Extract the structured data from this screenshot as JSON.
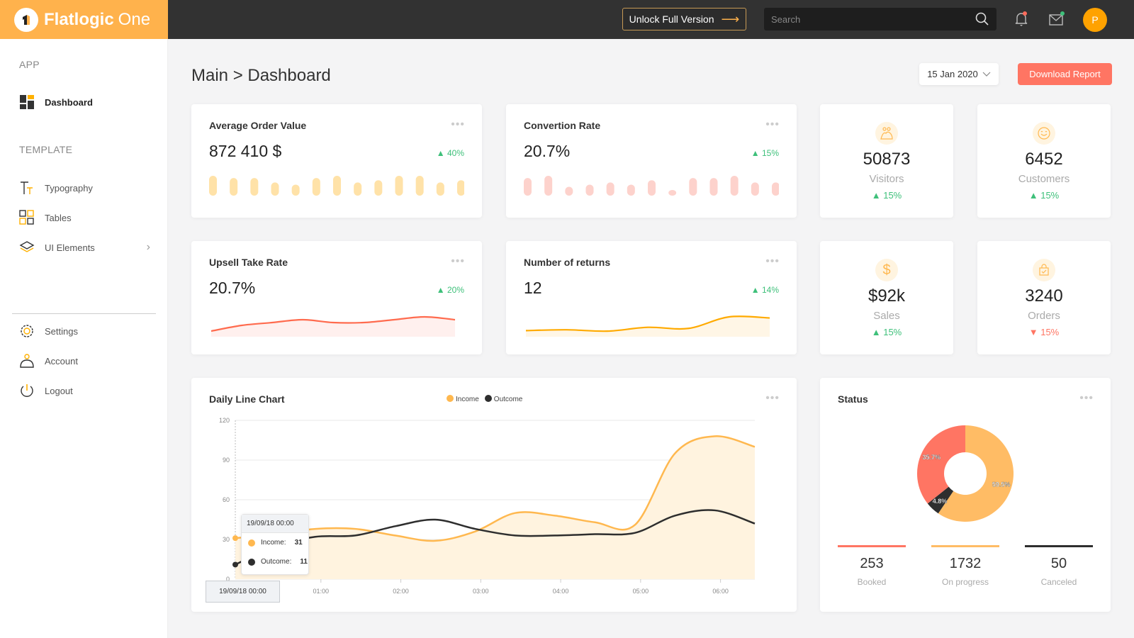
{
  "app": {
    "brand_bold": "Flatlogic",
    "brand_light": "One"
  },
  "topbar": {
    "unlock_label": "Unlock Full Version",
    "search_placeholder": "Search",
    "avatar_initial": "P",
    "colors": {
      "brand": "#ffb24c",
      "dark": "#323232",
      "notif_dot": "#ff6b5b",
      "mail_dot": "#3ec07a"
    }
  },
  "sidebar": {
    "sections": [
      {
        "label": "APP",
        "items": [
          {
            "label": "Dashboard",
            "icon": "dashboard-icon",
            "active": true
          }
        ]
      },
      {
        "label": "TEMPLATE",
        "items": [
          {
            "label": "Typography",
            "icon": "typography-icon"
          },
          {
            "label": "Tables",
            "icon": "tables-icon"
          },
          {
            "label": "UI Elements",
            "icon": "layers-icon",
            "has_submenu": true
          }
        ]
      }
    ],
    "bottom_items": [
      {
        "label": "Settings",
        "icon": "gear-icon"
      },
      {
        "label": "Account",
        "icon": "account-icon"
      },
      {
        "label": "Logout",
        "icon": "power-icon"
      }
    ]
  },
  "header": {
    "breadcrumb": "Main > Dashboard",
    "date": "15 Jan 2020",
    "download_label": "Download Report"
  },
  "kpis": [
    {
      "title": "Average Order Value",
      "value": "872 410 $",
      "delta": "40%",
      "trend": "up",
      "spark_type": "bars",
      "color": "#ffe2a8",
      "spark": [
        9,
        8,
        8,
        6,
        5,
        8,
        9,
        6,
        7,
        9,
        9,
        6,
        7
      ]
    },
    {
      "title": "Convertion Rate",
      "value": "20.7%",
      "delta": "15%",
      "trend": "up",
      "spark_type": "bars",
      "color": "#fdd2cc",
      "spark": [
        8,
        9,
        4,
        5,
        6,
        5,
        7,
        2,
        8,
        8,
        9,
        6,
        6
      ]
    },
    {
      "title": "Upsell Take Rate",
      "value": "20.7%",
      "delta": "20%",
      "trend": "up",
      "spark_type": "line",
      "color": "#ff6b4e",
      "fill": "#fff0ee",
      "spark": [
        2,
        4,
        5,
        6,
        5,
        5,
        6,
        7,
        6
      ]
    },
    {
      "title": "Number of returns",
      "value": "12",
      "delta": "14%",
      "trend": "up",
      "spark_type": "line",
      "color": "#ffaa00",
      "fill": "#fff6e6",
      "spark": [
        2,
        2.3,
        1.8,
        3.2,
        2.8,
        7,
        6.6
      ]
    }
  ],
  "stats": [
    {
      "value": "50873",
      "label": "Visitors",
      "delta": "15%",
      "trend": "up",
      "icon": "visitors-icon"
    },
    {
      "value": "6452",
      "label": "Customers",
      "delta": "15%",
      "trend": "up",
      "icon": "smiley-icon"
    },
    {
      "value": "$92k",
      "label": "Sales",
      "delta": "15%",
      "trend": "up",
      "icon": "dollar-icon"
    },
    {
      "value": "3240",
      "label": "Orders",
      "delta": "15%",
      "trend": "down",
      "icon": "shopping-bag-icon"
    }
  ],
  "daily_chart": {
    "title": "Daily Line Chart",
    "tooltip": {
      "header": "19/09/18 00:00",
      "rows": [
        {
          "label": "Income:",
          "value": "31"
        },
        {
          "label": "Outcome:",
          "value": "11"
        }
      ]
    },
    "x_tooltip": "19/09/18 00:00"
  },
  "status": {
    "title": "Status",
    "items": [
      {
        "value": "253",
        "label": "Booked",
        "color": "#ff7563"
      },
      {
        "value": "1732",
        "label": "On progress",
        "color": "#ffbc65"
      },
      {
        "value": "50",
        "label": "Canceled",
        "color": "#2e2e2e"
      }
    ]
  },
  "chart_data": [
    {
      "type": "area",
      "title": "Daily Line Chart",
      "xlabel": "",
      "ylabel": "",
      "x": [
        "00:00",
        "00:30",
        "01:00",
        "01:30",
        "02:00",
        "02:30",
        "03:00",
        "03:30",
        "04:00",
        "04:30",
        "05:00",
        "05:30",
        "06:00",
        "06:30"
      ],
      "x_ticks": [
        "01:00",
        "02:00",
        "03:00",
        "04:00",
        "05:00",
        "06:00"
      ],
      "y_ticks": [
        0,
        30,
        60,
        90,
        120
      ],
      "ylim": [
        0,
        120
      ],
      "grid": true,
      "legend": "top-center",
      "series": [
        {
          "name": "Income",
          "color": "#ffb84f",
          "fill": "#fff3df",
          "values": [
            31,
            34,
            38,
            38,
            33,
            29,
            36,
            50,
            48,
            43,
            41,
            95,
            108,
            100
          ]
        },
        {
          "name": "Outcome",
          "color": "#2e2e2e",
          "values": [
            11,
            25,
            32,
            33,
            40,
            45,
            38,
            33,
            33,
            34,
            35,
            48,
            52,
            42
          ]
        }
      ]
    },
    {
      "type": "pie",
      "title": "Status",
      "categories": [
        "On progress",
        "Canceled",
        "Booked"
      ],
      "values": [
        59.5,
        4.8,
        35.7
      ],
      "labels": [
        "59.5%",
        "4.8%",
        "35.7%"
      ],
      "colors": [
        "#ffbc65",
        "#2e2e2e",
        "#ff7563"
      ]
    }
  ]
}
